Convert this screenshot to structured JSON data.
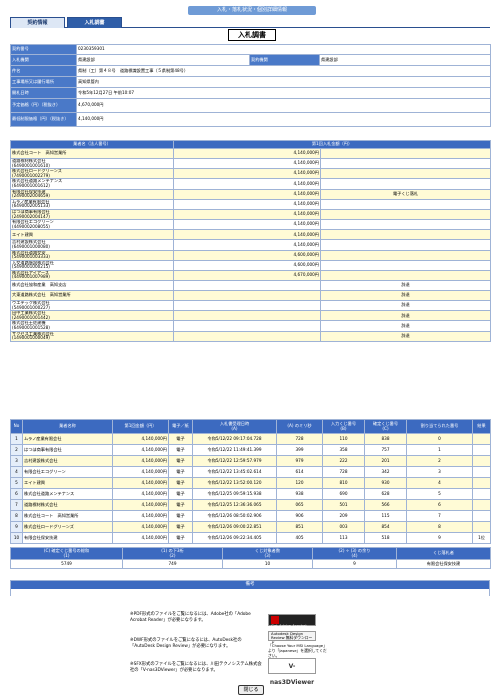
{
  "header": {
    "bar_title": "入札・落札状況・個別詳細情報",
    "page_title": "入札調書"
  },
  "tabs": [
    {
      "label": "契約情報"
    },
    {
      "label": "入札調書"
    }
  ],
  "info": [
    {
      "label": "契約番号",
      "value": "0230359301"
    },
    {
      "label": "入札機関",
      "value": "県建設部",
      "label2": "契約機関",
      "value2": "県建設部"
    },
    {
      "label": "件名",
      "value": "県制（工）第４８号　道路標識設置工事（５県制第48号）"
    },
    {
      "label": "工事場所又は履行場所",
      "value": "高知県管内"
    },
    {
      "label": "開札日時",
      "value": "令和5年12月27日 午前10:07"
    },
    {
      "label": "予定価格（円）（税抜き）",
      "value": "4,670,000円"
    },
    {
      "label": "最低制限価格（円）（税抜き）",
      "value": "4,140,000円"
    }
  ],
  "bidders_table": {
    "headers": [
      "業者名（法人番号）",
      "第1回入札金額（円）",
      ""
    ],
    "rows": [
      {
        "name": "株式会社コート　高知営業所",
        "amount": "4,140,000円",
        "note": ""
      },
      {
        "name": "道路標材株式会社\n(6490001001610)",
        "amount": "4,140,000円",
        "note": ""
      },
      {
        "name": "株式会社ロードグリーンズ\n(7490001002279)",
        "amount": "4,140,000円",
        "note": ""
      },
      {
        "name": "株式会社道路メンテナンス\n(6490001001612)",
        "amount": "4,140,000円",
        "note": ""
      },
      {
        "name": "有限会社保安技建\n(2490002004659)",
        "amount": "4,140,000円",
        "note": "電子くじ落札"
      },
      {
        "name": "ムラノ産業有限会社\n(6490002005133)",
        "amount": "4,140,000円",
        "note": ""
      },
      {
        "name": "はつほ商事有限会社\n(2490002004147)",
        "amount": "4,140,000円",
        "note": ""
      },
      {
        "name": "有限会社エコグリーン\n(4490002008055)",
        "amount": "4,140,000円",
        "note": ""
      },
      {
        "name": "エイト建興",
        "amount": "4,140,000円",
        "note": ""
      },
      {
        "name": "吉村建設株式会社\n(6490001000080)",
        "amount": "4,140,000円",
        "note": ""
      },
      {
        "name": "株式会社道路交安\n(5490001003333)",
        "amount": "4,600,000円",
        "note": ""
      },
      {
        "name": "入交道路施設株式会社\n(5490001000215)",
        "amount": "4,600,000円",
        "note": ""
      },
      {
        "name": "株式会社アイアース\n(4490001007989)",
        "amount": "4,670,000円",
        "note": ""
      },
      {
        "name": "株式会社協和産業　高知支店",
        "amount": "",
        "note": "辞退"
      },
      {
        "name": "大東道路株式会社　高知営業所",
        "amount": "",
        "note": "辞退"
      },
      {
        "name": "ウエテック株式会社\n(5490001000227)",
        "amount": "",
        "note": "辞退"
      },
      {
        "name": "田中工業株式会社\n(2490001001442)",
        "amount": "",
        "note": "辞退"
      },
      {
        "name": "株式会社土佐建機\n(6490001001528)",
        "amount": "",
        "note": "辞退"
      },
      {
        "name": "サクセス工業株式会社\n(1490001000049)",
        "amount": "",
        "note": "辞退"
      }
    ]
  },
  "lottery_table": {
    "headers": [
      "No",
      "業者名称",
      "第1回金額（円）",
      "電子／紙",
      "入札書受理日時\n(A)",
      "(A) のミリ秒",
      "入力くじ番号\n(B)",
      "確定くじ番号\n(C)",
      "割り当てられた番号",
      "結果"
    ],
    "rows": [
      [
        "1",
        "ムラノ産業有限会社",
        "4,140,000円",
        "電子",
        "令和5/12/22 09:17:04.728",
        "728",
        "110",
        "838",
        "0",
        ""
      ],
      [
        "2",
        "はつほ商事有限会社",
        "4,140,000円",
        "電子",
        "令和5/12/22 11:49:41.399",
        "399",
        "358",
        "757",
        "1",
        ""
      ],
      [
        "3",
        "吉村建設株式会社",
        "4,140,000円",
        "電子",
        "令和5/12/22 12:59:57.979",
        "979",
        "222",
        "201",
        "2",
        ""
      ],
      [
        "4",
        "有限会社エコグリーン",
        "4,140,000円",
        "電子",
        "令和5/12/22 13:45:02.614",
        "614",
        "728",
        "342",
        "3",
        ""
      ],
      [
        "5",
        "エイト建興",
        "4,140,000円",
        "電子",
        "令和5/12/22 13:52:00.120",
        "120",
        "810",
        "930",
        "4",
        ""
      ],
      [
        "6",
        "株式会社道路メンテナンス",
        "4,140,000円",
        "電子",
        "令和5/12/25 09:59:15.938",
        "938",
        "690",
        "628",
        "5",
        ""
      ],
      [
        "7",
        "道路標材株式会社",
        "4,140,000円",
        "電子",
        "令和5/12/25 12:36:36.065",
        "065",
        "501",
        "566",
        "6",
        ""
      ],
      [
        "8",
        "株式会社コート　高知営業所",
        "4,140,000円",
        "電子",
        "令和5/12/26 08:50:02.906",
        "906",
        "209",
        "115",
        "7",
        ""
      ],
      [
        "9",
        "株式会社ロードグリーンズ",
        "4,140,000円",
        "電子",
        "令和5/12/26 09:00:22.851",
        "851",
        "003",
        "854",
        "8",
        ""
      ],
      [
        "10",
        "有限会社保安技建",
        "4,140,000円",
        "電子",
        "令和5/12/26 09:22:34.405",
        "405",
        "113",
        "518",
        "9",
        "1位"
      ]
    ]
  },
  "summary_table": {
    "headers": [
      "(C) 確定くじ番号の総和\n(1)",
      "(1) の下3桁\n(2)",
      "くじ対象者数\n(3)",
      "(2) ÷ (3) の余り\n(4)",
      "くじ落札者"
    ],
    "values": [
      "5749",
      "749",
      "10",
      "9",
      "有限会社保安技建"
    ]
  },
  "remarks": {
    "label": "備考",
    "value": ""
  },
  "notes": [
    "※PDF形式のファイルをご覧になるには、Adobe社の「Adobe Acrobat Reader」が必要になります。",
    "※DWF形式のファイルをご覧になるには、AutoDesk社の「AutoDesk Design Review」が必要になります。",
    "※SFX形式のファイルをご覧になるには、川田テクノシステム株式会社の「V-nas3DViewer」が必要になります。"
  ],
  "badges": {
    "adobe": "Get Adobe Acrobat Reader",
    "autodesk": "Autodesk Design Review 無料ダウンロード",
    "msi": "「Choose Your MSI Language」より「Japanese」を選択してください。",
    "vnas": "V-nas3DViewer"
  },
  "close_label": "閉じる"
}
